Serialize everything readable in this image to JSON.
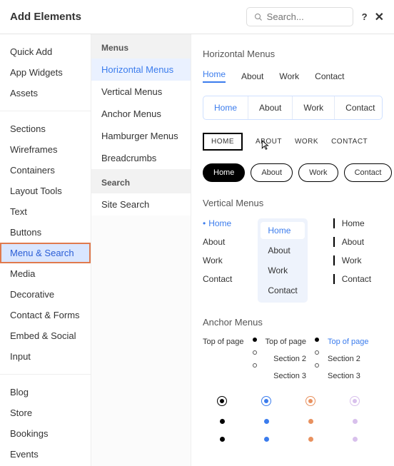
{
  "header": {
    "title": "Add Elements",
    "search_placeholder": "Search..."
  },
  "col1": {
    "group1": [
      "Quick Add",
      "App Widgets",
      "Assets"
    ],
    "group2": [
      "Sections",
      "Wireframes",
      "Containers",
      "Layout Tools",
      "Text",
      "Buttons",
      "Menu & Search",
      "Media",
      "Decorative",
      "Contact & Forms",
      "Embed & Social",
      "Input"
    ],
    "group3": [
      "Blog",
      "Store",
      "Bookings",
      "Events"
    ],
    "selected": "Menu & Search"
  },
  "col2": {
    "heading1": "Menus",
    "menus": [
      "Horizontal Menus",
      "Vertical Menus",
      "Anchor Menus",
      "Hamburger Menus",
      "Breadcrumbs"
    ],
    "menus_selected": "Horizontal Menus",
    "heading2": "Search",
    "search_items": [
      "Site Search"
    ]
  },
  "preview": {
    "horizontal_title": "Horizontal Menus",
    "vertical_title": "Vertical Menus",
    "anchor_title": "Anchor Menus",
    "items": [
      "Home",
      "About",
      "Work",
      "Contact"
    ],
    "items_upper": [
      "HOME",
      "ABOUT",
      "WORK",
      "CONTACT"
    ],
    "anchor": {
      "top": "Top of page",
      "s2": "Section 2",
      "s3": "Section 3"
    },
    "colors": {
      "black": "#000000",
      "blue": "#3b7ced",
      "orange": "#e8915f",
      "purple": "#c9a5e8"
    }
  }
}
